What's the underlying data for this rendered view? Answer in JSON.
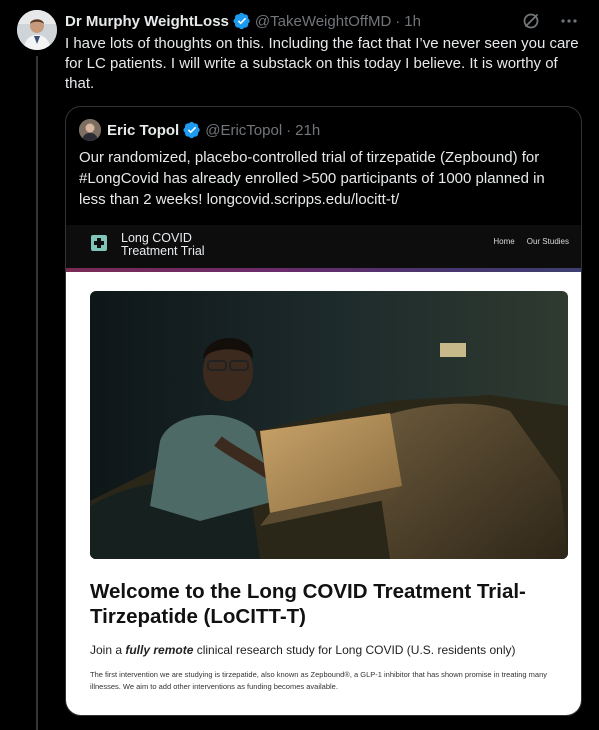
{
  "tweet": {
    "author_name": "Dr Murphy WeightLoss",
    "handle": "@TakeWeightOffMD",
    "separator": "·",
    "time": "1h",
    "text": "I have lots of thoughts on this. Including the fact that I’ve never seen you care for LC patients. I will write a substack on this today I believe. It is worthy of that."
  },
  "quote": {
    "author_name": "Eric Topol",
    "handle": "@EricTopol",
    "separator": "·",
    "time": "21h",
    "text": "Our randomized, placebo-controlled trial of tirzepatide (Zepbound) for #LongCovid has already enrolled >500 participants of 1000 planned in less than 2 weeks! longcovid.scripps.edu/locitt-t/"
  },
  "card": {
    "site_name_line1": "Long COVID",
    "site_name_line2": "Treatment Trial",
    "nav_home": "Home",
    "nav_studies": "Our Studies",
    "title": "Welcome to the Long COVID Treatment Trial-Tirzepatide (LoCITT-T)",
    "subtitle_prefix": "Join a ",
    "subtitle_emph": "fully remote",
    "subtitle_suffix": " clinical research study for Long COVID (U.S. residents only)",
    "body": "The first intervention we are studying is tirzepatide, also known as Zepbound®, a GLP-1 inhibitor that has shown promise in treating many illnesses. We aim to add other interventions as funding becomes available."
  },
  "colors": {
    "background": "#000000",
    "text_primary": "#e7e9ea",
    "text_secondary": "#71767b",
    "verified_blue": "#1d9bf0",
    "card_accent": "#6a2b6a"
  },
  "icons": {
    "verified": "verified-badge-icon",
    "grok": "grok-icon",
    "more": "more-icon",
    "site_logo": "cross-logo-icon"
  }
}
